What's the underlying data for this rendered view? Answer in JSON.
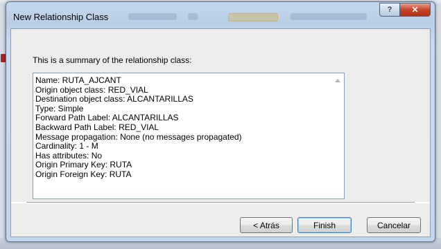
{
  "dialog": {
    "title": "New Relationship Class",
    "caption_buttons": {
      "help_label": "?",
      "close_label": "✕"
    }
  },
  "main": {
    "summary_label": "This is a summary of the relationship class:",
    "summary_lines": [
      "Name: RUTA_AJCANT",
      "Origin object class: RED_VIAL",
      "Destination object class: ALCANTARILLAS",
      "Type: Simple",
      "Forward Path Label: ALCANTARILLAS",
      "Backward Path Label: RED_VIAL",
      "Message propagation: None (no messages propagated)",
      "Cardinality: 1 - M",
      "Has attributes: No",
      "Origin Primary Key: RUTA",
      "Origin Foreign Key: RUTA"
    ]
  },
  "footer": {
    "back_label": "< Atrás",
    "finish_label": "Finish",
    "cancel_label": "Cancelar"
  },
  "colors": {
    "title_bar": "#bcd0e6",
    "close_button": "#c7442b",
    "default_button_border": "#3c7fb1"
  }
}
